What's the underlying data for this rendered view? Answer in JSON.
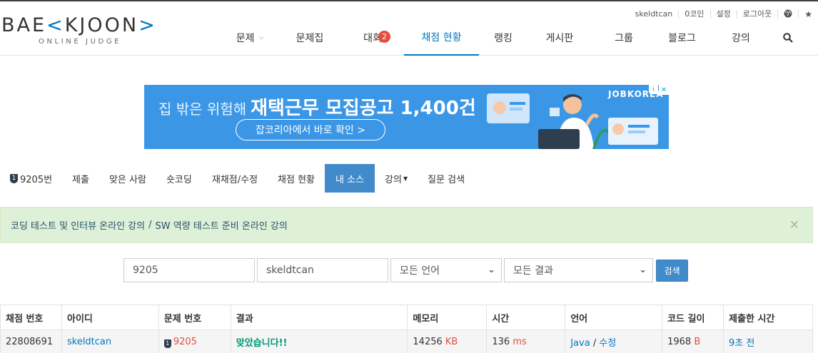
{
  "logo": {
    "main_left": "BAE",
    "main_mark": "K",
    "main_right": "JOON",
    "arrow_open": "<",
    "arrow_close": ">",
    "sub": "ONLINE JUDGE"
  },
  "userbar": {
    "username": "skeldtcan",
    "coins": "0코인",
    "settings": "설정",
    "logout": "로그아웃",
    "icons": [
      "globe-icon",
      "star-icon"
    ]
  },
  "mainnav": {
    "items": [
      "문제",
      "문제집",
      "대회",
      "채점 현황",
      "랭킹",
      "게시판",
      "그룹",
      "블로그",
      "강의"
    ],
    "contest_badge": "2",
    "active": "채점 현황"
  },
  "ad": {
    "line_small": "집 밖은 위험해",
    "line_big": "재택근무 모집공고 1,400건",
    "button": "잡코리아에서 바로 확인 >",
    "brand": "JOBKOREA",
    "close": "✕",
    "info": "i"
  },
  "subnav": {
    "problem_shield": "1",
    "items": [
      "9205번",
      "제출",
      "맞은 사람",
      "숏코딩",
      "재채점/수정",
      "채점 현황",
      "내 소스",
      "강의",
      "질문 검색"
    ],
    "active": "내 소스"
  },
  "alert": {
    "link1": "코딩 테스트 및 인터뷰 온라인 강의",
    "separator": "/",
    "link2": "SW 역량 테스트 준비 온라인 강의",
    "close": "×"
  },
  "filter": {
    "problem_id": "9205",
    "user_id": "skeldtcan",
    "language": "모든 언어",
    "result": "모든 결과",
    "search_button": "검색"
  },
  "table": {
    "headers": [
      "채점 번호",
      "아이디",
      "문제 번호",
      "결과",
      "메모리",
      "시간",
      "언어",
      "코드 길이",
      "제출한 시간"
    ],
    "rows": [
      {
        "id": "22808691",
        "user": "skeldtcan",
        "problem_shield": "1",
        "problem": "9205",
        "result": "맞았습니다!!",
        "memory": "14256",
        "memory_unit": "KB",
        "time": "136",
        "time_unit": "ms",
        "language": "Java",
        "lang_sep": "/",
        "edit": "수정",
        "code_length": "1968",
        "code_unit": "B",
        "submitted": "9초 전"
      }
    ]
  },
  "colors": {
    "accent": "#0076c0",
    "badge": "#e74c3c",
    "active_tab": "#428bca",
    "accepted": "#009874",
    "ad_bg": "#3b97e6"
  }
}
